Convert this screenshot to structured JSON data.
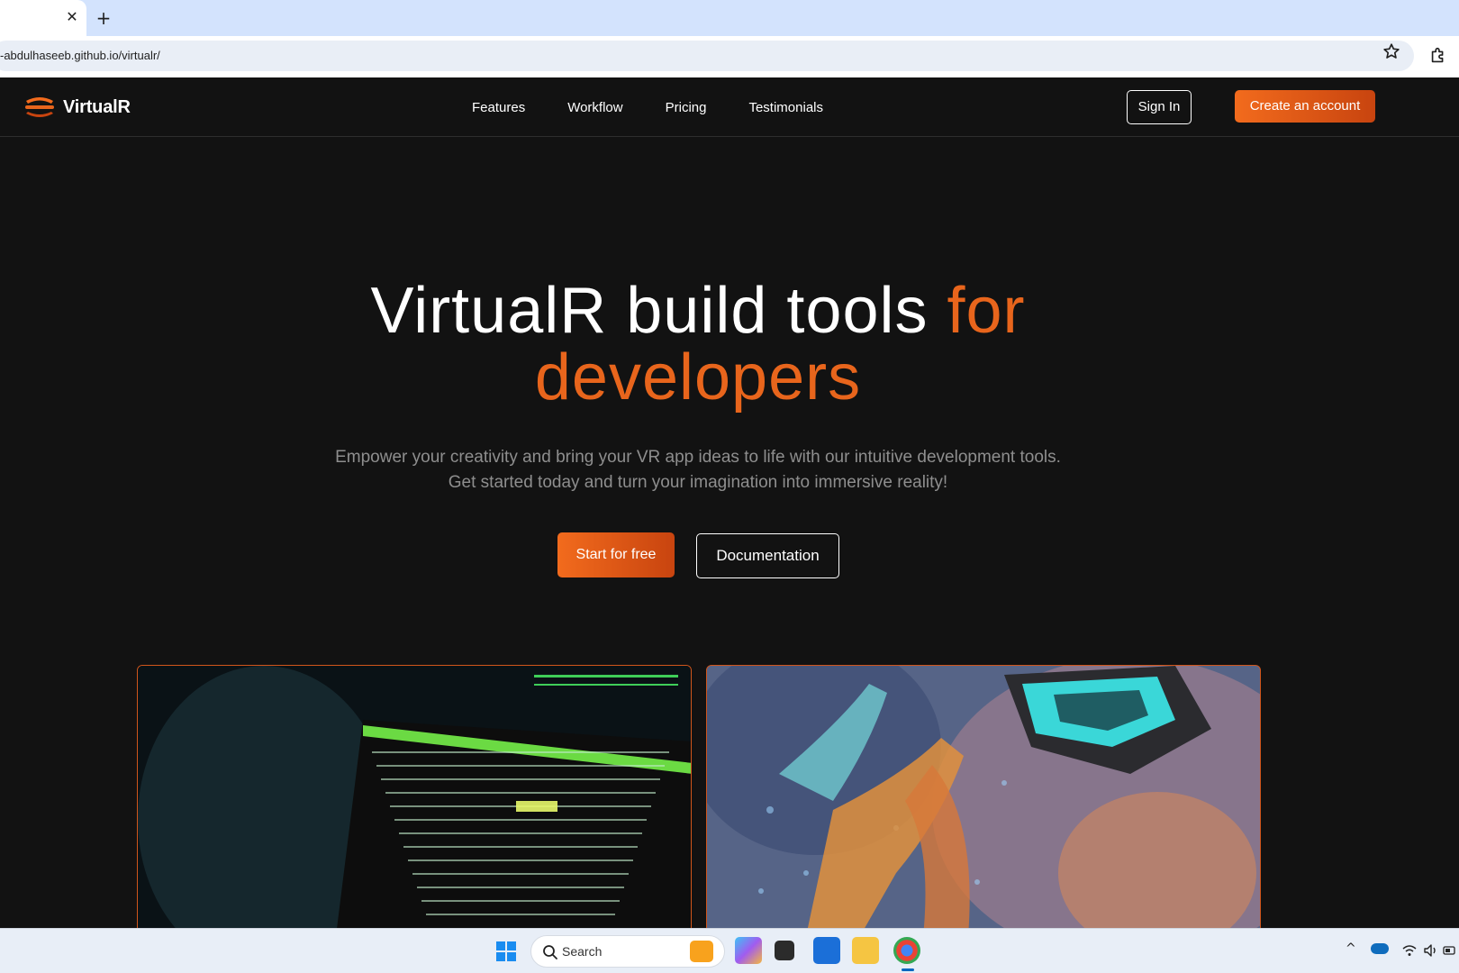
{
  "browser": {
    "tab_close": "✕",
    "new_tab": "+",
    "url": "-abdulhaseeb.github.io/virtualr/"
  },
  "site": {
    "logo_text": "VirtualR",
    "nav": {
      "links": [
        "Features",
        "Workflow",
        "Pricing",
        "Testimonials"
      ],
      "sign_in": "Sign In",
      "create_account": "Create an account"
    },
    "hero": {
      "title_main": "VirtualR build tools ",
      "title_accent_1": "for",
      "title_accent_2": "developers",
      "subtitle_line1": "Empower your creativity and bring your VR app ideas to life with our intuitive development tools.",
      "subtitle_line2": "Get started today and turn your imagination into immersive reality!",
      "primary_cta": "Start for free",
      "secondary_cta": "Documentation"
    },
    "accent_color": "#e8651c"
  },
  "taskbar": {
    "search_placeholder": "Search",
    "tray_chevron": "^"
  }
}
